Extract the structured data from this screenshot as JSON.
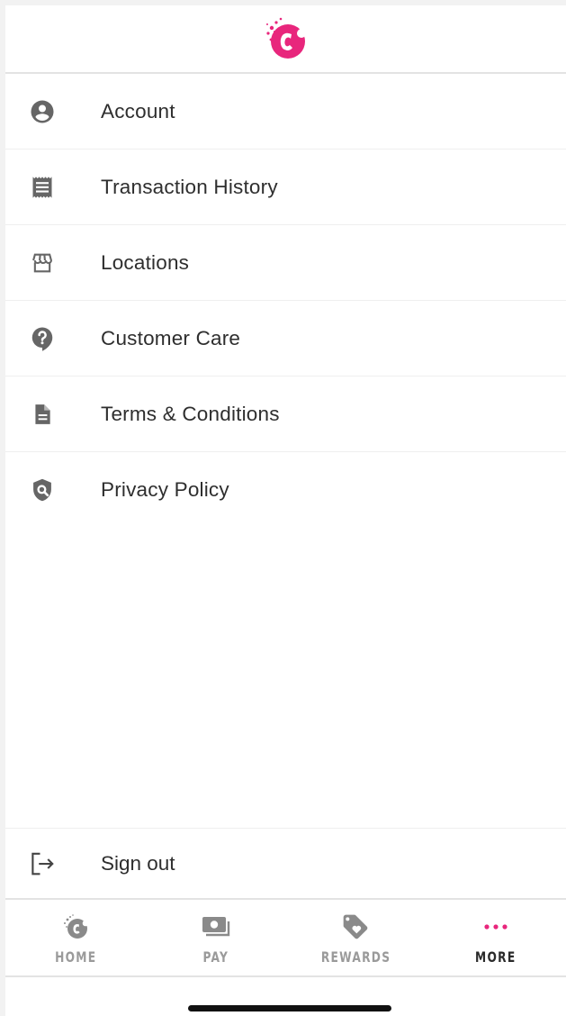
{
  "header": {
    "logo_icon": "brand-c-logo"
  },
  "menu": {
    "items": [
      {
        "label": "Account",
        "icon": "account-circle-icon"
      },
      {
        "label": "Transaction History",
        "icon": "receipt-icon"
      },
      {
        "label": "Locations",
        "icon": "storefront-icon"
      },
      {
        "label": "Customer Care",
        "icon": "help-bubble-icon"
      },
      {
        "label": "Terms & Conditions",
        "icon": "document-icon"
      },
      {
        "label": "Privacy Policy",
        "icon": "privacy-shield-icon"
      }
    ],
    "signout": {
      "label": "Sign out",
      "icon": "logout-icon"
    }
  },
  "tabbar": {
    "tabs": [
      {
        "label": "HOME",
        "icon": "brand-c-icon",
        "active": false
      },
      {
        "label": "PAY",
        "icon": "cash-icon",
        "active": false
      },
      {
        "label": "REWARDS",
        "icon": "tag-heart-icon",
        "active": false
      },
      {
        "label": "MORE",
        "icon": "more-dots-icon",
        "active": true
      }
    ]
  },
  "colors": {
    "brand": "#e8267c",
    "icon_gray": "#666666",
    "text": "#2e2e2e",
    "tab_inactive": "#9a9a9a"
  }
}
